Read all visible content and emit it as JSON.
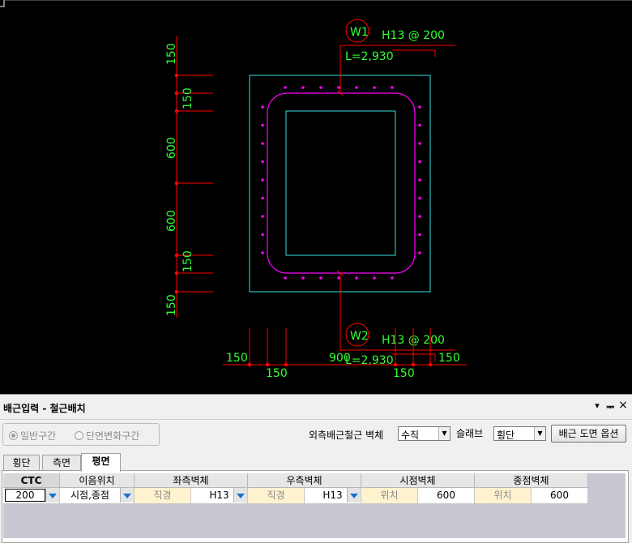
{
  "drawing": {
    "callout_top": {
      "tag": "W1",
      "rebar": "H13 @ 200",
      "length": "L=2,930"
    },
    "callout_bottom": {
      "tag": "W2",
      "rebar": "H13 @ 200",
      "length": "L=2,930"
    },
    "dim_vertical": [
      "150",
      "150",
      "600",
      "600",
      "150",
      "150"
    ],
    "dim_bottom": {
      "left": "150",
      "left_below": "150",
      "mid": "900",
      "right": "150",
      "right_below": "150"
    }
  },
  "panel": {
    "title": "배근입력 - 철근배치",
    "controls": {
      "dropdown": "▾",
      "pin": "ᆍ",
      "close": "×"
    },
    "section_type": {
      "options": [
        "일반구간",
        "단면변화구간"
      ],
      "selected": "일반구간"
    },
    "outer_rebar": {
      "label": "외측배근철근 벽체",
      "value": "수직"
    },
    "slab": {
      "label": "슬래브",
      "value": "횡단"
    },
    "options_button": "배근 도면 옵션",
    "tabs": [
      "횡단",
      "측면",
      "평면"
    ],
    "active_tab": "평면",
    "grid": {
      "headers": {
        "ctc": "CTC",
        "splice": "이음위치",
        "left_wall": "좌측벽체",
        "right_wall": "우측벽체",
        "start_wall": "시점벽체",
        "end_wall": "종점벽체"
      },
      "row": {
        "ctc": "200",
        "splice": "시점,종점",
        "left_sub": "직경",
        "left_val": "H13",
        "right_sub": "직경",
        "right_val": "H13",
        "start_sub": "위치",
        "start_val": "600",
        "end_sub": "위치",
        "end_val": "600"
      }
    }
  },
  "colors": {
    "cad_background": "#000000",
    "dimension_red": "#ff0000",
    "text_green": "#33ff33",
    "rebar_magenta": "#ff00ff",
    "concrete_cyan": "#33e0e0"
  }
}
